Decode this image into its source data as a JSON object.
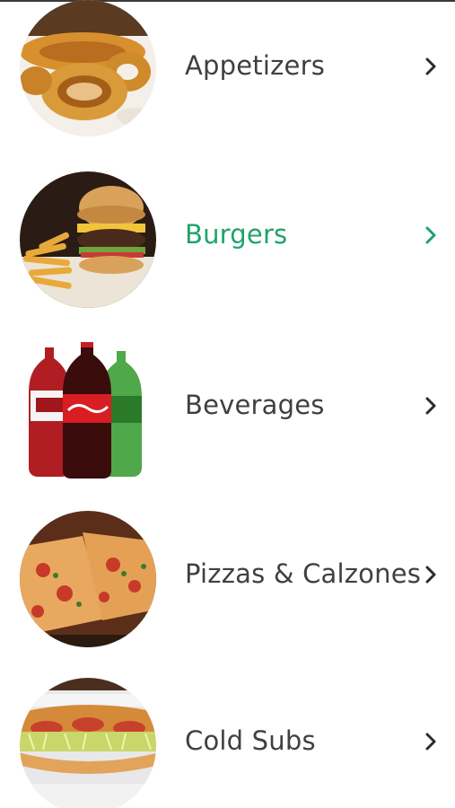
{
  "colors": {
    "text": "#404040",
    "selected": "#1fa36b",
    "background": "#ffffff"
  },
  "categories": [
    {
      "label": "Appetizers",
      "image": "onion-rings-image",
      "selected": false
    },
    {
      "label": "Burgers",
      "image": "burger-fries-image",
      "selected": true
    },
    {
      "label": "Beverages",
      "image": "soda-bottles-image",
      "selected": false
    },
    {
      "label": "Pizzas & Calzones",
      "image": "pizza-slices-image",
      "selected": false
    },
    {
      "label": "Cold Subs",
      "image": "sub-sandwich-image",
      "selected": false
    }
  ]
}
